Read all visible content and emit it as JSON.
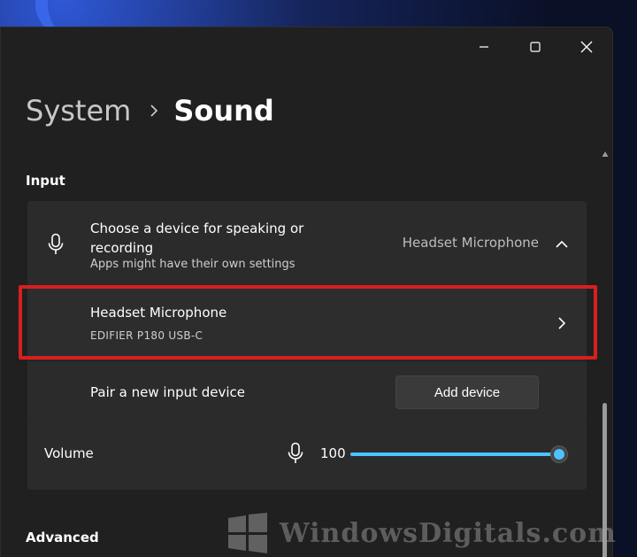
{
  "breadcrumb": {
    "parent": "System",
    "current": "Sound"
  },
  "sections": {
    "input": "Input",
    "advanced": "Advanced"
  },
  "input": {
    "choose_label": "Choose a device for speaking or recording",
    "choose_sub": "Apps might have their own settings",
    "selected_device": "Headset Microphone",
    "device": {
      "name": "Headset Microphone",
      "model": "EDIFIER P180 USB-C"
    },
    "pair_label": "Pair a new input device",
    "add_device_label": "Add device"
  },
  "volume": {
    "label": "Volume",
    "value": "100",
    "level_percent": 100
  },
  "watermark": {
    "text": "WindowsDigitals.com"
  },
  "colors": {
    "accent": "#4cc2ff",
    "highlight": "#d91e1e",
    "window_bg": "#202020",
    "card_bg": "#2b2b2b"
  },
  "icons": {
    "minimize": "minimize-icon",
    "maximize": "maximize-icon",
    "close": "close-icon",
    "breadcrumb_separator": "chevron-right-icon",
    "microphone": "microphone-icon",
    "expand": "chevron-up-icon",
    "device_open": "chevron-right-icon"
  }
}
